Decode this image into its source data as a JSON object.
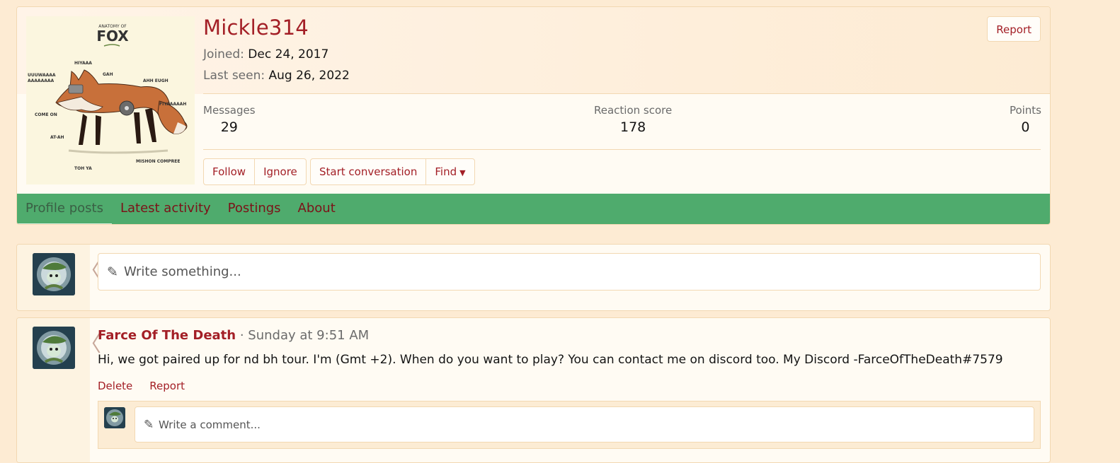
{
  "profile": {
    "username": "Mickle314",
    "joined_label": "Joined:",
    "joined_value": "Dec 24, 2017",
    "last_seen_label": "Last seen:",
    "last_seen_value": "Aug 26, 2022",
    "report_label": "Report",
    "stats": [
      {
        "label": "Messages",
        "value": "29"
      },
      {
        "label": "Reaction score",
        "value": "178"
      },
      {
        "label": "Points",
        "value": "0"
      }
    ],
    "buttons": {
      "follow": "Follow",
      "ignore": "Ignore",
      "start_conversation": "Start conversation",
      "find": "Find"
    },
    "tabs": [
      "Profile posts",
      "Latest activity",
      "Postings",
      "About"
    ],
    "avatar_art_text": {
      "title_small": "ANATOMY OF",
      "title_big": "FOX",
      "labels": [
        "HIYAAA",
        "UUUWAAAA AAAAAAAA",
        "GAH",
        "AHH EUGH",
        "FIYAAAAAH",
        "COME ON",
        "AT-AH",
        "TOH YA",
        "MISHON COMPREE"
      ]
    }
  },
  "composer": {
    "placeholder": "Write something..."
  },
  "post": {
    "author": "Farce Of The Death",
    "separator": "·",
    "time": "Sunday at 9:51 AM",
    "message": "Hi, we got paired up for nd bh tour. I'm (Gmt +2). When do you want to play? You can contact me on discord too. My Discord -FarceOfTheDeath#7579",
    "actions": {
      "delete": "Delete",
      "report": "Report"
    },
    "comment_placeholder": "Write a comment..."
  },
  "colors": {
    "page_bg": "#fdebd3",
    "link": "#a31f26",
    "tab_bar": "#4fab6d",
    "border": "#f2d8b2"
  },
  "icons": [
    "pencil-icon",
    "caret-down-icon",
    "left-arrow-icon"
  ]
}
